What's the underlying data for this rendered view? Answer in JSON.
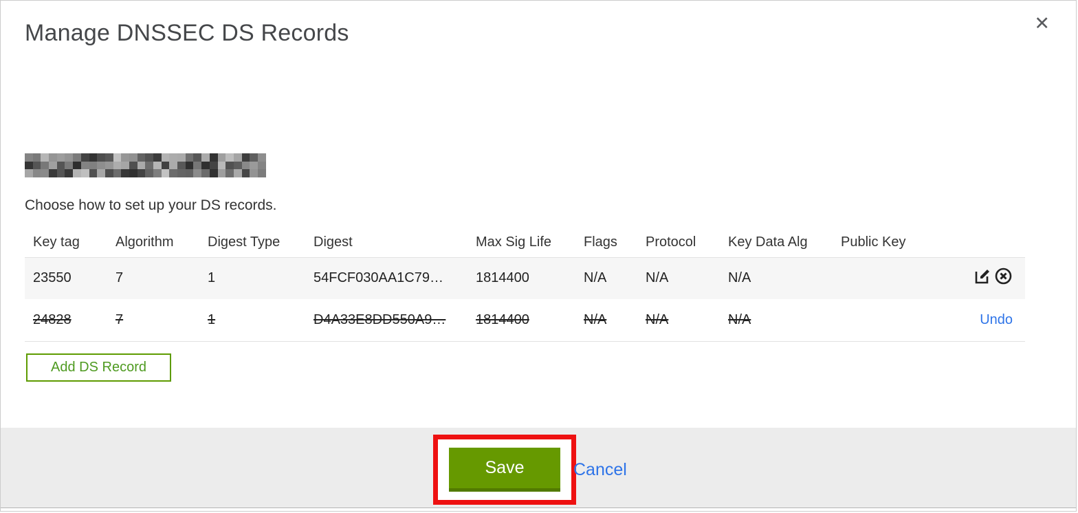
{
  "dialog": {
    "title": "Manage DNSSEC DS Records",
    "close_glyph": "✕",
    "instruction": "Choose how to set up your DS records."
  },
  "table": {
    "columns": [
      "Key tag",
      "Algorithm",
      "Digest Type",
      "Digest",
      "Max Sig Life",
      "Flags",
      "Protocol",
      "Key Data Alg",
      "Public Key"
    ],
    "rows": [
      {
        "key_tag": "23550",
        "algorithm": "7",
        "digest_type": "1",
        "digest": "54FCF030AA1C79…",
        "max_sig_life": "1814400",
        "flags": "N/A",
        "protocol": "N/A",
        "key_data_alg": "N/A",
        "public_key": "",
        "state": "active"
      },
      {
        "key_tag": "24828",
        "algorithm": "7",
        "digest_type": "1",
        "digest": "D4A33E8DD550A9…",
        "max_sig_life": "1814400",
        "flags": "N/A",
        "protocol": "N/A",
        "key_data_alg": "N/A",
        "public_key": "",
        "state": "marked-for-deletion",
        "undo_label": "Undo"
      }
    ]
  },
  "buttons": {
    "add_ds_record": "Add DS Record",
    "save": "Save",
    "cancel": "Cancel"
  },
  "colors": {
    "primary_green": "#669900",
    "outline_green": "#5d9b00",
    "link_blue": "#2e74e8",
    "annotation_red": "#ee1111",
    "footer_gray": "#ececec",
    "row_gray": "#f6f6f6"
  }
}
